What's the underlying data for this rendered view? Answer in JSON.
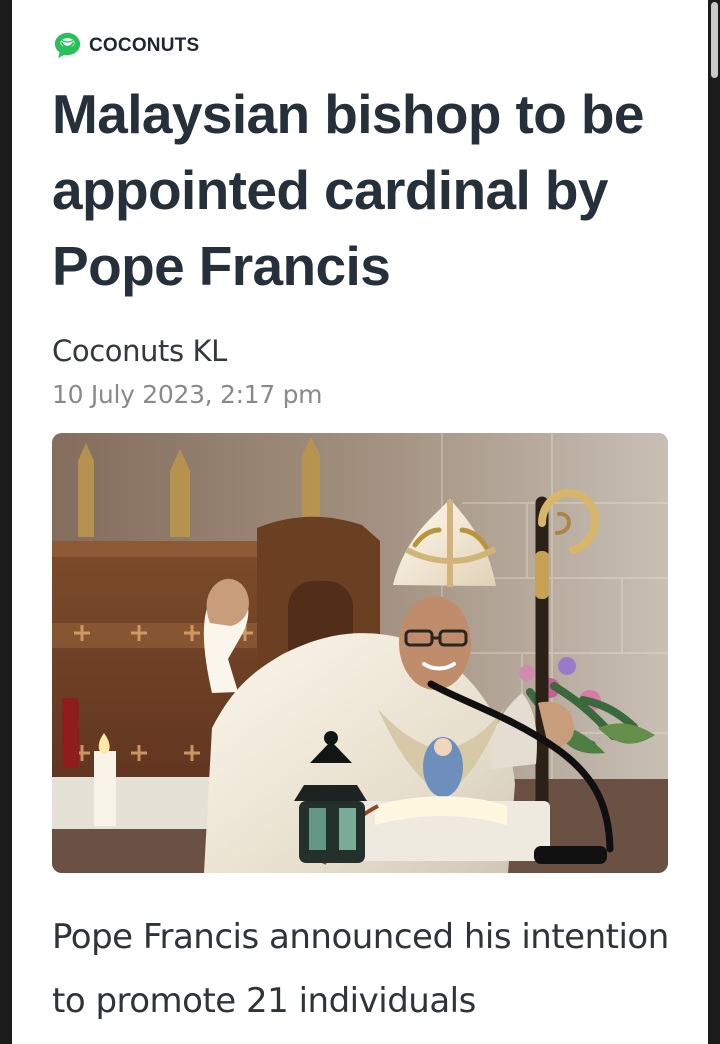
{
  "brand": {
    "name": "COCONUTS",
    "icon": "coconut-chat-bubble-icon",
    "accent_color": "#29c05b"
  },
  "article": {
    "title": "Malaysian bishop to be appointed cardinal by Pope Francis",
    "author": "Coconuts KL",
    "date": "10 July 2023, 2:17 pm",
    "image": {
      "subject": "bishop-with-mitre-and-crozier-at-altar"
    },
    "body_preview": "Pope Francis announced his intention to promote 21 individuals"
  },
  "colors": {
    "page_background": "#ffffff",
    "frame_background": "#1b1b1b",
    "title_color": "#25303b",
    "meta_color": "#8a8a8a"
  }
}
